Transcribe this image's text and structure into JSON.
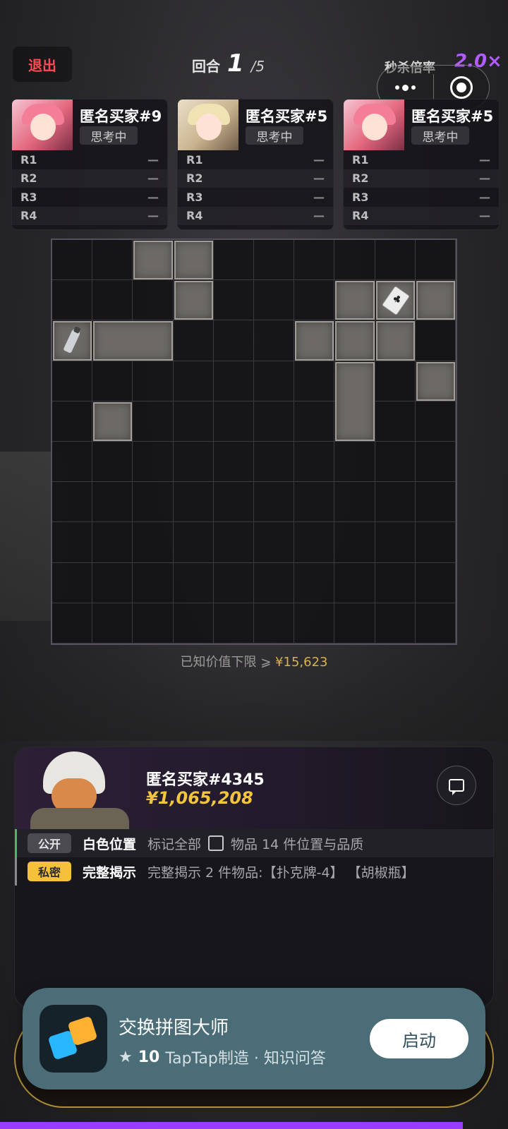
{
  "header": {
    "exit_label": "退出",
    "round_label": "回合",
    "round_current": "1",
    "round_total": "/5",
    "kill_rate_label": "秒杀倍率",
    "kill_rate_value": "2.0×"
  },
  "players": [
    {
      "name": "匿名买家#9",
      "status": "思考中",
      "avatar": "pink-hair-girl",
      "rounds": [
        {
          "label": "R1",
          "value": "—"
        },
        {
          "label": "R2",
          "value": "—"
        },
        {
          "label": "R3",
          "value": "—"
        },
        {
          "label": "R4",
          "value": "—"
        }
      ]
    },
    {
      "name": "匿名买家#5",
      "status": "思考中",
      "avatar": "blonde-girl",
      "rounds": [
        {
          "label": "R1",
          "value": "—"
        },
        {
          "label": "R2",
          "value": "—"
        },
        {
          "label": "R3",
          "value": "—"
        },
        {
          "label": "R4",
          "value": "—"
        }
      ]
    },
    {
      "name": "匿名买家#5",
      "status": "思考中",
      "avatar": "pink-hair-girl",
      "rounds": [
        {
          "label": "R1",
          "value": "—"
        },
        {
          "label": "R2",
          "value": "—"
        },
        {
          "label": "R3",
          "value": "—"
        },
        {
          "label": "R4",
          "value": "—"
        }
      ]
    }
  ],
  "grid": {
    "cols": 10,
    "rows": 10,
    "items": [
      {
        "col": 2,
        "row": 0,
        "w": 1,
        "h": 1
      },
      {
        "col": 3,
        "row": 0,
        "w": 1,
        "h": 1
      },
      {
        "col": 3,
        "row": 1,
        "w": 1,
        "h": 1
      },
      {
        "col": 7,
        "row": 1,
        "w": 1,
        "h": 1
      },
      {
        "col": 8,
        "row": 1,
        "w": 1,
        "h": 1,
        "icon": "playing-card-icon"
      },
      {
        "col": 9,
        "row": 1,
        "w": 1,
        "h": 1
      },
      {
        "col": 0,
        "row": 2,
        "w": 1,
        "h": 1,
        "icon": "pepper-bottle-icon"
      },
      {
        "col": 1,
        "row": 2,
        "w": 2,
        "h": 1
      },
      {
        "col": 6,
        "row": 2,
        "w": 1,
        "h": 1
      },
      {
        "col": 7,
        "row": 2,
        "w": 1,
        "h": 1
      },
      {
        "col": 8,
        "row": 2,
        "w": 1,
        "h": 1
      },
      {
        "col": 7,
        "row": 3,
        "w": 1,
        "h": 2
      },
      {
        "col": 9,
        "row": 3,
        "w": 1,
        "h": 1
      },
      {
        "col": 1,
        "row": 4,
        "w": 1,
        "h": 1
      }
    ]
  },
  "known_value": {
    "label": "已知价值下限 ⩾ ",
    "amount": "¥15,623"
  },
  "buyer": {
    "name": "匿名买家#4345",
    "money": "¥1,065,208",
    "avatar": "fox-pilot"
  },
  "clues": [
    {
      "tag": "公开",
      "title": "白色位置",
      "desc_before": "标记全部",
      "desc_after": "物品 14 件位置与品质"
    },
    {
      "tag": "私密",
      "title": "完整揭示",
      "desc": "完整揭示 2 件物品:【扑克牌-4】 【胡椒瓶】"
    }
  ],
  "app_popup": {
    "name": "交换拼图大师",
    "rating": "10",
    "meta": "TapTap制造 · 知识问答",
    "launch_label": "启动"
  },
  "colors": {
    "accent_purple": "#b05cff",
    "gold": "#f2c53d",
    "exit_red": "#ff4b55",
    "popup_bg": "#4a6d78"
  }
}
